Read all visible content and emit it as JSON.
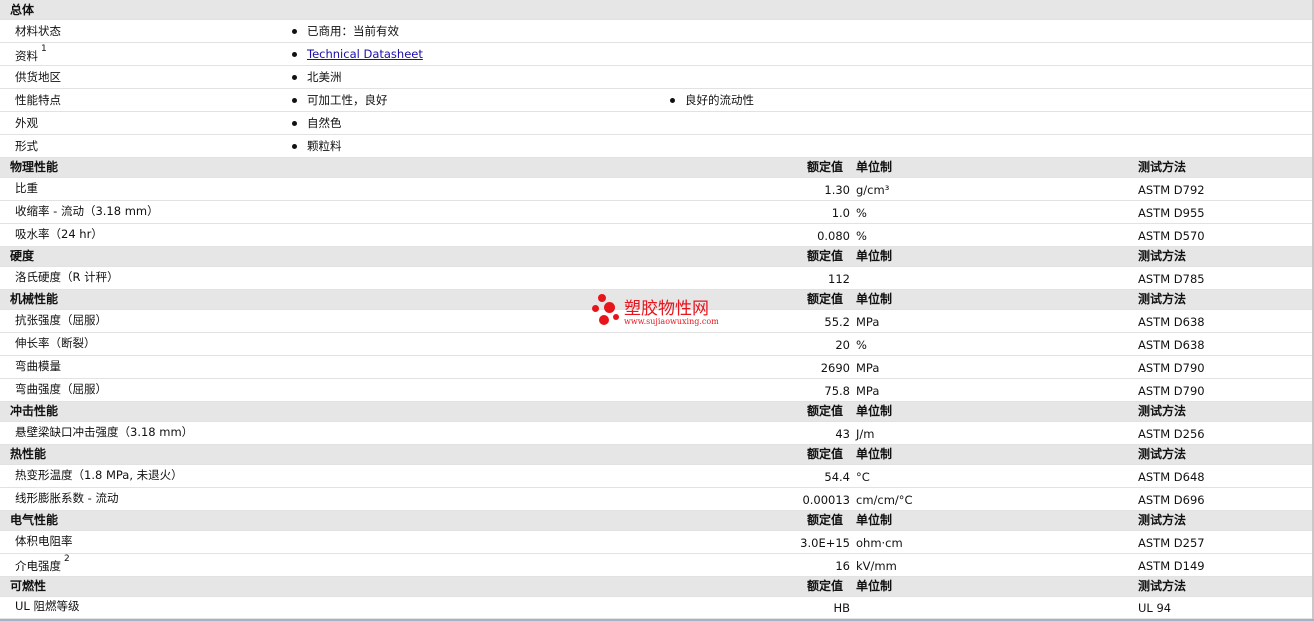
{
  "sections": {
    "general": {
      "title": "总体",
      "rows": [
        {
          "label": "材料状态",
          "items": [
            "已商用：当前有效"
          ]
        },
        {
          "label": "资料",
          "sup": "1",
          "link": "Technical Datasheet"
        },
        {
          "label": "供货地区",
          "items": [
            "北美洲"
          ]
        },
        {
          "label": "性能特点",
          "items": [
            "可加工性，良好",
            "良好的流动性"
          ]
        },
        {
          "label": "外观",
          "items": [
            "自然色"
          ]
        },
        {
          "label": "形式",
          "items": [
            "颗粒料"
          ]
        }
      ]
    },
    "physical": {
      "title": "物理性能",
      "rows": [
        {
          "label": "比重",
          "value": "1.30",
          "unit": "g/cm³",
          "method": "ASTM D792"
        },
        {
          "label": "收缩率 - 流动（3.18 mm）",
          "value": "1.0",
          "unit": "%",
          "method": "ASTM D955"
        },
        {
          "label": "吸水率（24 hr）",
          "value": "0.080",
          "unit": "%",
          "method": "ASTM D570"
        }
      ]
    },
    "hardness": {
      "title": "硬度",
      "rows": [
        {
          "label": "洛氏硬度（R 计秤）",
          "value": "112",
          "unit": "",
          "method": "ASTM D785"
        }
      ]
    },
    "mechanical": {
      "title": "机械性能",
      "rows": [
        {
          "label": "抗张强度（屈服）",
          "value": "55.2",
          "unit": "MPa",
          "method": "ASTM D638"
        },
        {
          "label": "伸长率（断裂）",
          "value": "20",
          "unit": "%",
          "method": "ASTM D638"
        },
        {
          "label": "弯曲模量",
          "value": "2690",
          "unit": "MPa",
          "method": "ASTM D790"
        },
        {
          "label": "弯曲强度（屈服）",
          "value": "75.8",
          "unit": "MPa",
          "method": "ASTM D790"
        }
      ]
    },
    "impact": {
      "title": "冲击性能",
      "rows": [
        {
          "label": "悬壁梁缺口冲击强度（3.18 mm）",
          "value": "43",
          "unit": "J/m",
          "method": "ASTM D256"
        }
      ]
    },
    "thermal": {
      "title": "热性能",
      "rows": [
        {
          "label": "热变形温度（1.8 MPa, 未退火）",
          "value": "54.4",
          "unit": "°C",
          "method": "ASTM D648"
        },
        {
          "label": "线形膨胀系数 - 流动",
          "value": "0.00013",
          "unit": "cm/cm/°C",
          "method": "ASTM D696"
        }
      ]
    },
    "electrical": {
      "title": "电气性能",
      "rows": [
        {
          "label": "体积电阻率",
          "value": "3.0E+15",
          "unit": "ohm·cm",
          "method": "ASTM D257"
        },
        {
          "label": "介电强度",
          "sup": "2",
          "value": "16",
          "unit": "kV/mm",
          "method": "ASTM D149"
        }
      ]
    },
    "flammability": {
      "title": "可燃性",
      "rows": [
        {
          "label": "UL 阻燃等级",
          "value": "HB",
          "unit": "",
          "method": "UL 94"
        }
      ]
    }
  },
  "columns": {
    "value": "额定值",
    "unit": "单位制",
    "method": "测试方法"
  },
  "watermark": {
    "title": "塑胶物性网",
    "url": "www.sujiaowuxing.com"
  },
  "colors": {
    "header_bg": "#e6e6e6",
    "link": "#1a0dab",
    "watermark": "#e8141b"
  }
}
